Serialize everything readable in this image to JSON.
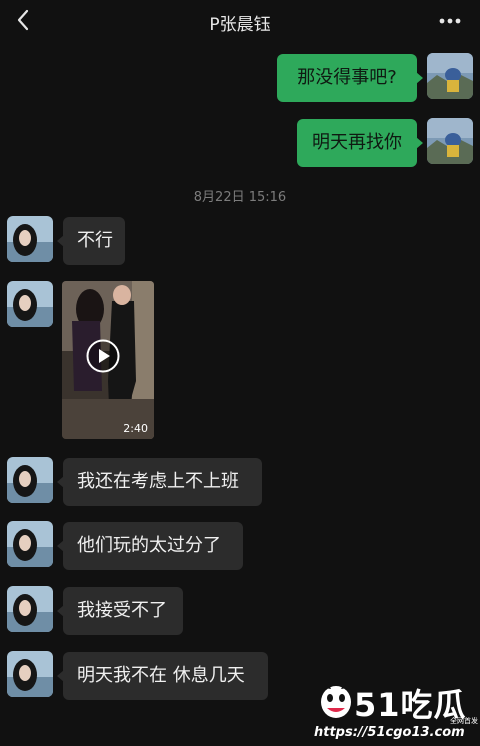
{
  "header": {
    "title": "P张晨钰",
    "back_icon": "chevron-left-icon",
    "more_icon": "more-dots-icon"
  },
  "messages": [
    {
      "from": "me",
      "text": "那没得事吧?"
    },
    {
      "from": "me",
      "text": "明天再找你"
    },
    {
      "type": "timestamp",
      "text": "8月22日 15:16"
    },
    {
      "from": "them",
      "text": "不行"
    },
    {
      "from": "them",
      "type": "video",
      "duration": "2:40"
    },
    {
      "from": "them",
      "text": "我还在考虑上不上班"
    },
    {
      "from": "them",
      "text": "他们玩的太过分了"
    },
    {
      "from": "them",
      "text": "我接受不了"
    },
    {
      "from": "them",
      "text": "明天我不在 休息几天"
    }
  ],
  "watermark": {
    "brand": "51吃瓜",
    "tag": "全网首发",
    "url": "https://51cgo13.com"
  },
  "colors": {
    "background": "#111111",
    "my_bubble": "#2ea95b",
    "their_bubble": "#2c2c2c"
  }
}
